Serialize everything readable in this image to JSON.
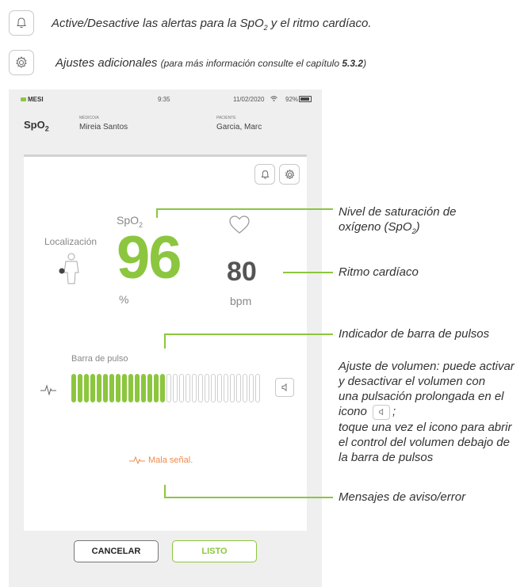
{
  "legend": {
    "alerts_text": "Active/Desactive las alertas para la SpO",
    "alerts_sub": "2",
    "alerts_text_end": " y el ritmo cardíaco.",
    "settings_text": "Ajustes adicionales ",
    "settings_small": "(para más información consulte el capítulo ",
    "settings_bold": "5.3.2",
    "settings_small_end": ")"
  },
  "device": {
    "brand": "MESI",
    "time": "9:35",
    "date": "11/02/2020",
    "battery": "92%",
    "screen_title_main": "SpO",
    "screen_title_sub": "2",
    "doctor_label": "MÉDICO/A",
    "doctor_name": "Mireia Santos",
    "patient_label": "PACIENTE",
    "patient_name": "Garcia, Marc",
    "spo2_label_main": "SpO",
    "spo2_label_sub": "2",
    "spo2_value": "96",
    "spo2_unit": "%",
    "heart_rate_value": "80",
    "heart_rate_unit": "bpm",
    "location_label": "Localización",
    "pulse_bar_label": "Barra de pulso",
    "pulse_bar_level": 0.5,
    "pulse_bar_filled": 15,
    "pulse_bar_total": 30,
    "warning_text": "Mala señal.",
    "cancel_label": "CANCELAR",
    "ok_label": "LISTO"
  },
  "callouts": {
    "spo2_level_line1": "Nivel de saturación de",
    "spo2_level_line2_a": "oxígeno (SpO",
    "spo2_level_line2_sub": "2",
    "spo2_level_line2_b": ")",
    "heart_rate": "Ritmo cardíaco",
    "pulse_bar_indicator": "Indicador de barra de pulsos",
    "volume_1": "Ajuste de volumen: puede activar",
    "volume_2": "y desactivar el volumen con",
    "volume_3": "una pulsación prolongada en el",
    "volume_4a": "icono",
    "volume_4b": ";",
    "volume_5": "toque una vez el icono para abrir",
    "volume_6": "el control del volumen debajo de",
    "volume_7": "la barra de pulsos",
    "messages": "Mensajes de aviso/error"
  },
  "colors": {
    "accent_green": "#8cc63f",
    "warning_orange": "#f08a4b",
    "background_gray": "#efefef"
  }
}
